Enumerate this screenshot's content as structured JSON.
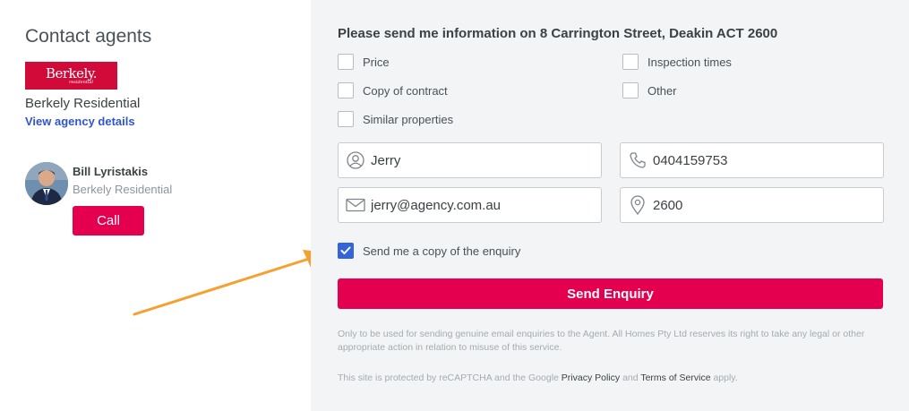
{
  "left": {
    "heading": "Contact agents",
    "agency": {
      "logo_text": "Berkely.",
      "logo_subtext": "residential",
      "name": "Berkely Residential",
      "details_link": "View agency details"
    },
    "agent": {
      "name": "Bill Lyristakis",
      "agency": "Berkely Residential",
      "call_label": "Call"
    }
  },
  "form": {
    "title": "Please send me information on 8 Carrington Street, Deakin ACT 2600",
    "options": [
      {
        "label": "Price",
        "checked": false
      },
      {
        "label": "Inspection times",
        "checked": false
      },
      {
        "label": "Copy of contract",
        "checked": false
      },
      {
        "label": "Other",
        "checked": false
      },
      {
        "label": "Similar properties",
        "checked": false
      }
    ],
    "fields": {
      "name": {
        "value": "Jerry",
        "icon": "user-icon"
      },
      "phone": {
        "value": "0404159753",
        "icon": "phone-icon"
      },
      "email": {
        "value": "jerry@agency.com.au",
        "icon": "envelope-icon"
      },
      "postcode": {
        "value": "2600",
        "icon": "location-pin-icon"
      }
    },
    "copy_checkbox": {
      "label": "Send me a copy of the enquiry",
      "checked": true
    },
    "submit_label": "Send Enquiry",
    "disclaimer": "Only to be used for sending genuine email enquiries to the Agent. All Homes Pty Ltd reserves its right to take any legal or other appropriate action in relation to misuse of this service.",
    "recaptcha": {
      "prefix": "This site is protected by reCAPTCHA and the Google",
      "privacy_link": "Privacy Policy",
      "and": "and",
      "terms_link": "Terms of Service",
      "suffix": "apply."
    }
  },
  "colors": {
    "brand_red": "#e4004f",
    "logo_red": "#d10a3a",
    "link_blue": "#2f55cf",
    "checkbox_blue": "#3364d8",
    "annotation_arrow": "#f5a030",
    "panel_bg": "#f2f4f6"
  }
}
